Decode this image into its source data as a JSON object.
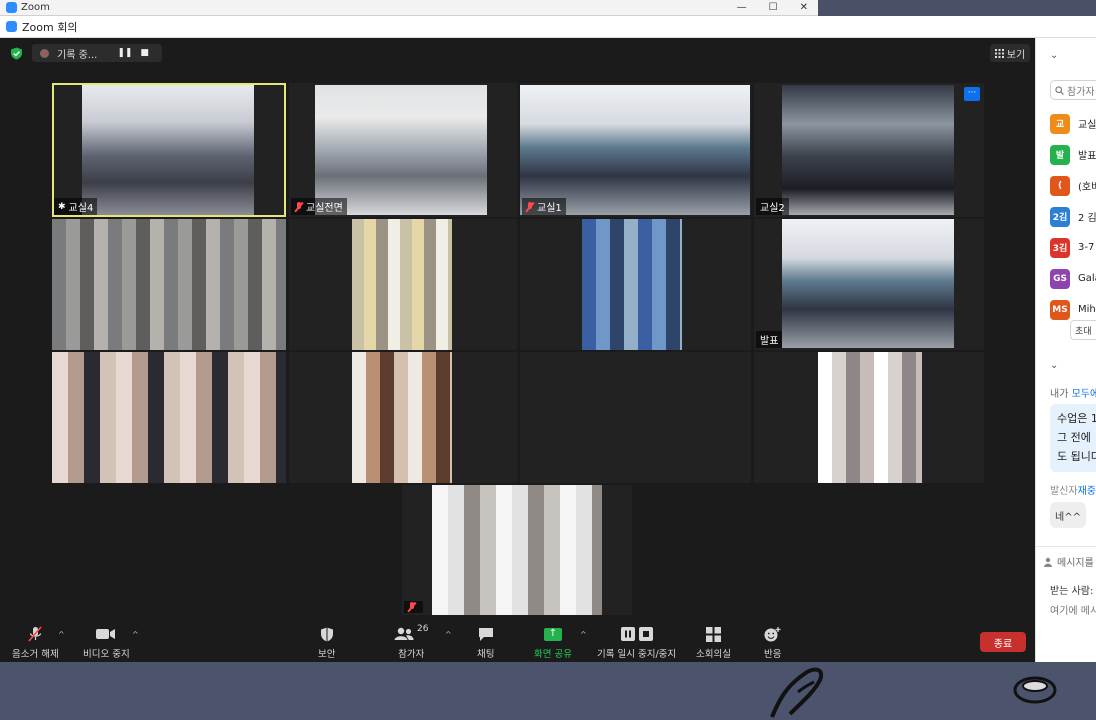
{
  "back_window": {
    "title": "Zoom"
  },
  "window": {
    "title": "Zoom 회의"
  },
  "topbar": {
    "recording_label": "기록 중...",
    "pause_glyph": "❚❚",
    "stop_glyph": "■",
    "view_label": "보기"
  },
  "tiles": [
    {
      "name": "교실4",
      "muted": false
    },
    {
      "name": "교실전면",
      "muted": true
    },
    {
      "name": "교실1",
      "muted": true
    },
    {
      "name": "교실2",
      "muted": false
    },
    {
      "name": "",
      "muted": false
    },
    {
      "name": "",
      "muted": false
    },
    {
      "name": "",
      "muted": false
    },
    {
      "name": "발표",
      "muted": false
    },
    {
      "name": "",
      "muted": false
    },
    {
      "name": "",
      "muted": false
    },
    {
      "name": "",
      "muted": false
    },
    {
      "name": "",
      "muted": false
    },
    {
      "name": "",
      "muted": true
    }
  ],
  "toolbar": {
    "unmute": "음소거 해제",
    "stop_video": "비디오 중지",
    "security": "보안",
    "participants": "참가자",
    "participants_count": "26",
    "chat": "채팅",
    "share_screen": "화면 공유",
    "pause_stop_recording": "기록 일시 중지/중지",
    "breakout": "소회의실",
    "reactions": "반응",
    "end": "종료"
  },
  "panel": {
    "search_placeholder": "참가자",
    "participants": [
      {
        "initial": "교",
        "name": "교실",
        "color": "#f08a19"
      },
      {
        "initial": "발",
        "name": "발표",
        "color": "#23b24b"
      },
      {
        "initial": "(",
        "name": "(호바",
        "color": "#e0561b"
      },
      {
        "initial": "2김",
        "name": "2 김",
        "color": "#2d7fd4"
      },
      {
        "initial": "3김",
        "name": "3-7",
        "color": "#d9352c"
      },
      {
        "initial": "GS",
        "name": "Gala",
        "color": "#8e44ad"
      },
      {
        "initial": "MS",
        "name": "Mih",
        "color": "#e0561b"
      }
    ],
    "invite": "초대",
    "chat_from_prefix": "내가",
    "chat_from_target": "모두에",
    "chat_lines": [
      "수업은 1",
      "그 전에",
      "도 됩니다"
    ],
    "sender_prefix": "발신자",
    "sender_name": "재중",
    "reply": "네^^",
    "message_hint": "메시지를",
    "to_label": "받는 사람:",
    "type_here": "여기에 메시"
  },
  "colors": {
    "speaker_highlight": "#e8e57a",
    "share_green": "#23b24b",
    "end_red": "#c8302e",
    "accent_blue": "#0e71eb"
  }
}
